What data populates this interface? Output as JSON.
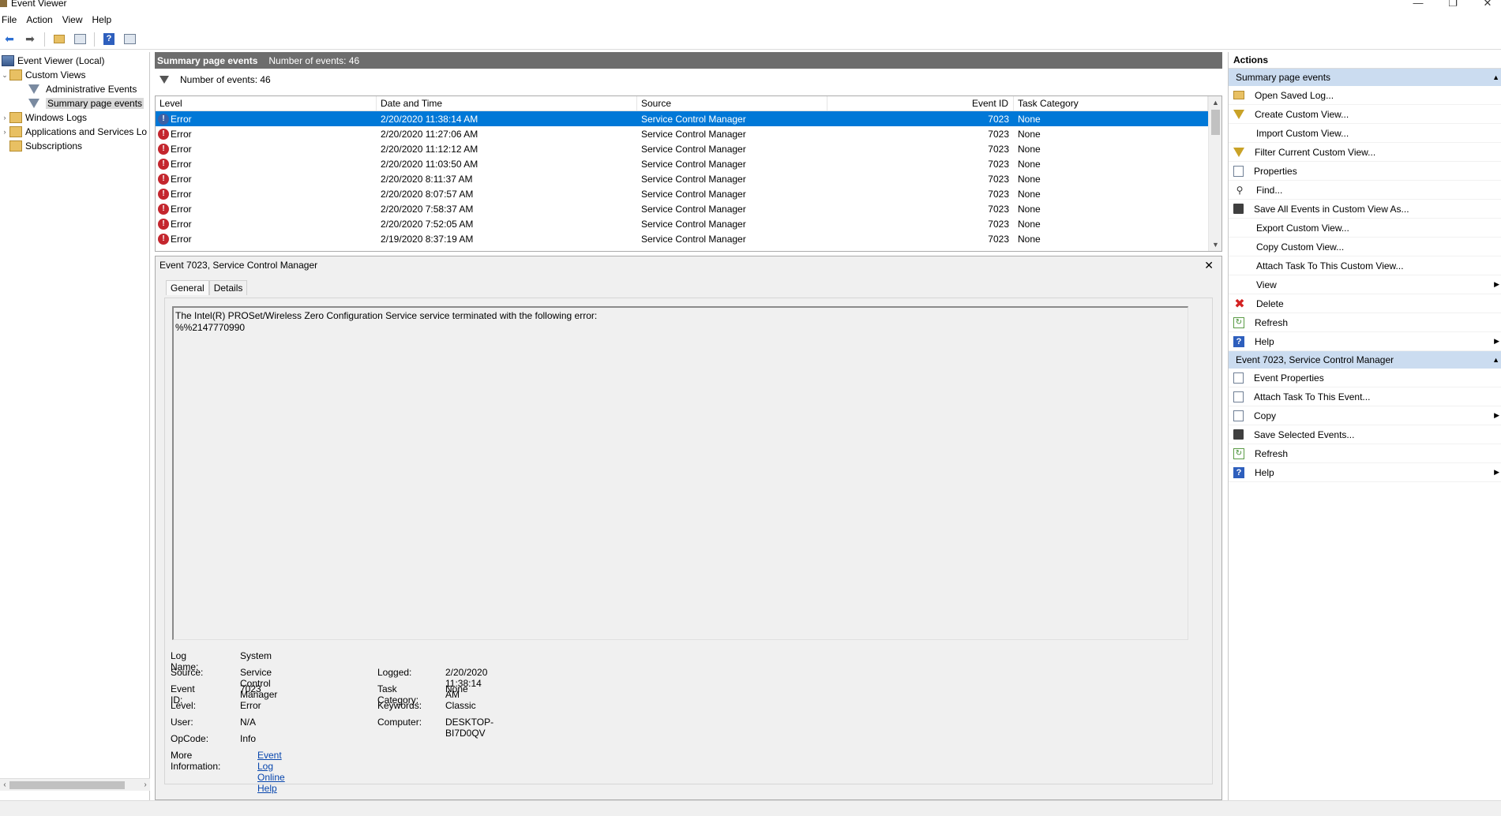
{
  "window": {
    "title": "Event Viewer",
    "minimize": "—",
    "restore": "❐",
    "close": "✕"
  },
  "menu": [
    "File",
    "Action",
    "View",
    "Help"
  ],
  "tree": {
    "root": "Event Viewer (Local)",
    "custom_views": "Custom Views",
    "admin_events": "Administrative Events",
    "summary_events": "Summary page events",
    "windows_logs": "Windows Logs",
    "apps_services": "Applications and Services Lo",
    "subscriptions": "Subscriptions"
  },
  "center": {
    "header_title": "Summary page events",
    "header_count": "Number of events: 46",
    "filter_text": "Number of events: 46",
    "columns": [
      "Level",
      "Date and Time",
      "Source",
      "Event ID",
      "Task Category"
    ],
    "rows": [
      {
        "level": "Error",
        "date": "2/20/2020 11:38:14 AM",
        "source": "Service Control Manager",
        "id": "7023",
        "cat": "None",
        "selected": true
      },
      {
        "level": "Error",
        "date": "2/20/2020 11:27:06 AM",
        "source": "Service Control Manager",
        "id": "7023",
        "cat": "None"
      },
      {
        "level": "Error",
        "date": "2/20/2020 11:12:12 AM",
        "source": "Service Control Manager",
        "id": "7023",
        "cat": "None"
      },
      {
        "level": "Error",
        "date": "2/20/2020 11:03:50 AM",
        "source": "Service Control Manager",
        "id": "7023",
        "cat": "None"
      },
      {
        "level": "Error",
        "date": "2/20/2020 8:11:37 AM",
        "source": "Service Control Manager",
        "id": "7023",
        "cat": "None"
      },
      {
        "level": "Error",
        "date": "2/20/2020 8:07:57 AM",
        "source": "Service Control Manager",
        "id": "7023",
        "cat": "None"
      },
      {
        "level": "Error",
        "date": "2/20/2020 7:58:37 AM",
        "source": "Service Control Manager",
        "id": "7023",
        "cat": "None"
      },
      {
        "level": "Error",
        "date": "2/20/2020 7:52:05 AM",
        "source": "Service Control Manager",
        "id": "7023",
        "cat": "None"
      },
      {
        "level": "Error",
        "date": "2/19/2020 8:37:19 AM",
        "source": "Service Control Manager",
        "id": "7023",
        "cat": "None"
      }
    ]
  },
  "detail": {
    "title": "Event 7023, Service Control Manager",
    "close": "✕",
    "tabs": [
      "General",
      "Details"
    ],
    "description_line1": "The Intel(R) PROSet/Wireless Zero Configuration Service service terminated with the following error:",
    "description_line2": "%%2147770990",
    "props": {
      "log_name_label": "Log Name:",
      "log_name": "System",
      "source_label": "Source:",
      "source": "Service Control Manager",
      "logged_label": "Logged:",
      "logged": "2/20/2020 11:38:14 AM",
      "event_id_label": "Event ID:",
      "event_id": "7023",
      "task_cat_label": "Task Category:",
      "task_cat": "None",
      "level_label": "Level:",
      "level": "Error",
      "keywords_label": "Keywords:",
      "keywords": "Classic",
      "user_label": "User:",
      "user": "N/A",
      "computer_label": "Computer:",
      "computer": "DESKTOP-BI7D0QV",
      "opcode_label": "OpCode:",
      "opcode": "Info",
      "more_info_label": "More Information:",
      "more_info_link": "Event Log Online Help"
    }
  },
  "actions": {
    "title": "Actions",
    "group1": "Summary page events",
    "group1_items": [
      {
        "label": "Open Saved Log...",
        "icon": "folder-icon"
      },
      {
        "label": "Create Custom View...",
        "icon": "filter-icon"
      },
      {
        "label": "Import Custom View...",
        "icon": ""
      },
      {
        "label": "Filter Current Custom View...",
        "icon": "filter-icon"
      },
      {
        "label": "Properties",
        "icon": "properties-icon"
      },
      {
        "label": "Find...",
        "icon": "find-icon"
      },
      {
        "label": "Save All Events in Custom View As...",
        "icon": "save-icon"
      },
      {
        "label": "Export Custom View...",
        "icon": ""
      },
      {
        "label": "Copy Custom View...",
        "icon": ""
      },
      {
        "label": "Attach Task To This Custom View...",
        "icon": ""
      },
      {
        "label": "View",
        "icon": "",
        "submenu": true
      },
      {
        "label": "Delete",
        "icon": "delete-icon"
      },
      {
        "label": "Refresh",
        "icon": "refresh-icon"
      },
      {
        "label": "Help",
        "icon": "help-icon",
        "submenu": true
      }
    ],
    "group2": "Event 7023, Service Control Manager",
    "group2_items": [
      {
        "label": "Event Properties",
        "icon": "properties-icon"
      },
      {
        "label": "Attach Task To This Event...",
        "icon": "task-icon"
      },
      {
        "label": "Copy",
        "icon": "copy-icon",
        "submenu": true
      },
      {
        "label": "Save Selected Events...",
        "icon": "save-icon"
      },
      {
        "label": "Refresh",
        "icon": "refresh-icon"
      },
      {
        "label": "Help",
        "icon": "help-icon",
        "submenu": true
      }
    ]
  }
}
